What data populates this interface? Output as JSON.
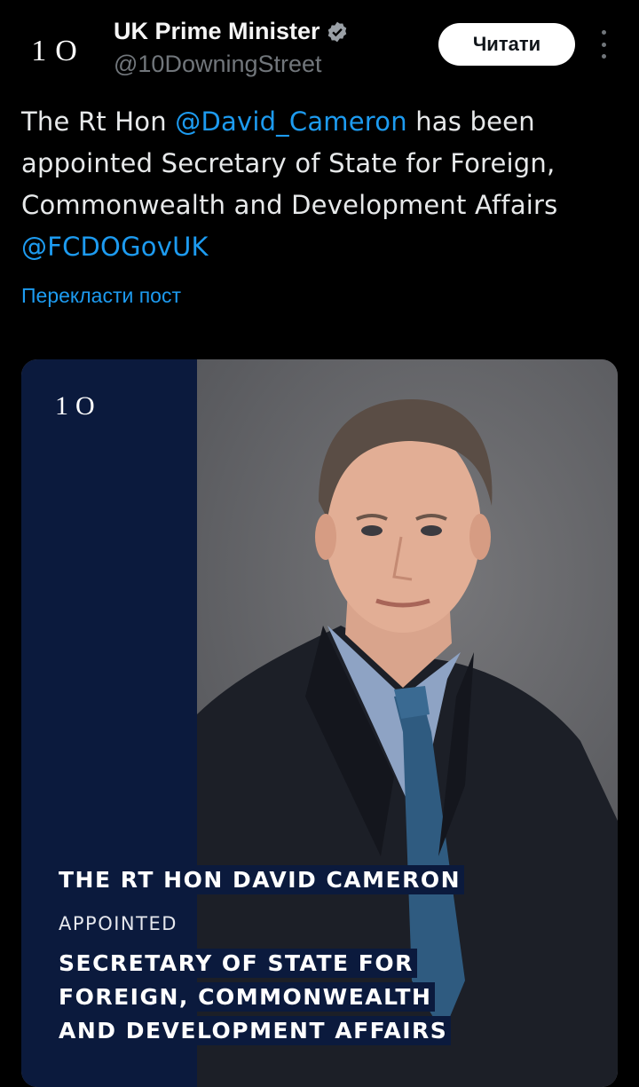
{
  "account": {
    "avatar_text": "1O",
    "display_name": "UK Prime Minister",
    "handle": "@10DowningStreet",
    "follow_label": "Читати"
  },
  "tweet": {
    "text_prefix": "The Rt Hon ",
    "mention_1": "@David_Cameron",
    "text_middle": " has been appointed Secretary of State for Foreign, Commonwealth and Development Affairs ",
    "mention_2": "@FCDOGovUK",
    "translate_label": "Перекласти пост"
  },
  "media": {
    "logo_text": "1O",
    "caption_name": "THE RT HON DAVID CAMERON",
    "caption_appointed": "APPOINTED",
    "caption_role_lines": [
      "SECRETARY OF STATE FOR",
      "FOREIGN, COMMONWEALTH",
      "AND DEVELOPMENT AFFAIRS"
    ]
  },
  "colors": {
    "accent": "#1d9bf0",
    "navy": "#0b1a3d",
    "background": "#000000"
  },
  "icons": {
    "verified": "verified-badge-icon",
    "more": "more-vertical-icon"
  }
}
